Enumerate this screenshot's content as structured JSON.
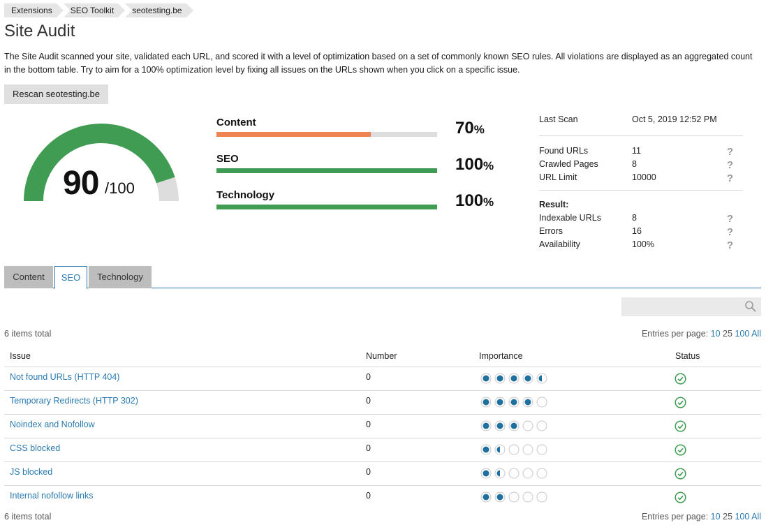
{
  "breadcrumb": [
    "Extensions",
    "SEO Toolkit",
    "seotesting.be"
  ],
  "title": "Site Audit",
  "description": "The Site Audit scanned your site, validated each URL, and scored it with a level of optimization based on a set of commonly known SEO rules. All violations are displayed as an aggregated count in the bottom table. Try to aim for a 100% optimization level by fixing all issues on the URLs shown when you click on a specific issue.",
  "rescan_label": "Rescan seotesting.be",
  "gauge": {
    "score": "90",
    "max": "/100",
    "fraction": 0.9,
    "color": "#3f9c52"
  },
  "categories": [
    {
      "name": "Content",
      "value": "70",
      "unit": "%",
      "fraction": 0.7,
      "color": "#ef8354"
    },
    {
      "name": "SEO",
      "value": "100",
      "unit": "%",
      "fraction": 1.0,
      "color": "#3f9c52"
    },
    {
      "name": "Technology",
      "value": "100",
      "unit": "%",
      "fraction": 1.0,
      "color": "#3f9c52"
    }
  ],
  "stats": {
    "last_scan_label": "Last Scan",
    "last_scan_value": "Oct 5, 2019 12:52 PM",
    "found_urls_label": "Found URLs",
    "found_urls_value": "11",
    "crawled_pages_label": "Crawled Pages",
    "crawled_pages_value": "8",
    "url_limit_label": "URL Limit",
    "url_limit_value": "10000",
    "result_label": "Result:",
    "indexable_label": "Indexable URLs",
    "indexable_value": "8",
    "errors_label": "Errors",
    "errors_value": "16",
    "availability_label": "Availability",
    "availability_value": "100%",
    "help_glyph": "?"
  },
  "tabs": [
    "Content",
    "SEO",
    "Technology"
  ],
  "active_tab": "SEO",
  "search": {
    "placeholder": ""
  },
  "items_total": "6 items total",
  "entries": {
    "label": "Entries per page:",
    "options": [
      "10",
      "25",
      "100",
      "All"
    ],
    "selected": "25"
  },
  "table": {
    "headers": {
      "issue": "Issue",
      "number": "Number",
      "importance": "Importance",
      "status": "Status"
    },
    "rows": [
      {
        "issue": "Not found URLs (HTTP 404)",
        "number": "0",
        "importance": 4.5
      },
      {
        "issue": "Temporary Redirects (HTTP 302)",
        "number": "0",
        "importance": 4
      },
      {
        "issue": "Noindex and Nofollow",
        "number": "0",
        "importance": 3
      },
      {
        "issue": "CSS blocked",
        "number": "0",
        "importance": 1.5
      },
      {
        "issue": "JS blocked",
        "number": "0",
        "importance": 1.5
      },
      {
        "issue": "Internal nofollow links",
        "number": "0",
        "importance": 2
      }
    ]
  },
  "colors": {
    "accent": "#2a7ab0",
    "ok": "#3f9c52",
    "dot": "#1f6f9f"
  },
  "icons": {
    "search": "search-icon",
    "status_ok": "check-circle-icon",
    "help": "help-icon"
  }
}
